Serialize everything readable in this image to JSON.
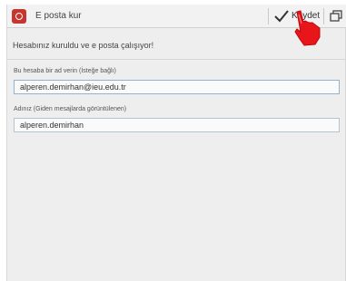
{
  "actionbar": {
    "title": "E posta kur",
    "save_label": "Kaydet",
    "icons": {
      "app": "mail-app-icon",
      "save": "check-icon",
      "window": "window-restore-icon"
    }
  },
  "status": {
    "message": "Hesabınız kuruldu ve e posta çalışıyor!"
  },
  "fields": {
    "account_name": {
      "label": "Bu hesaba bir ad verin (İsteğe bağlı)",
      "value": "alperen.demirhan@ieu.edu.tr"
    },
    "display_name": {
      "label": "Adınız (Giden mesajlarda görüntülenen)",
      "value": "alperen.demirhan"
    }
  },
  "colors": {
    "accent": "#c7352f",
    "cursor_hand": "#e8161b"
  }
}
